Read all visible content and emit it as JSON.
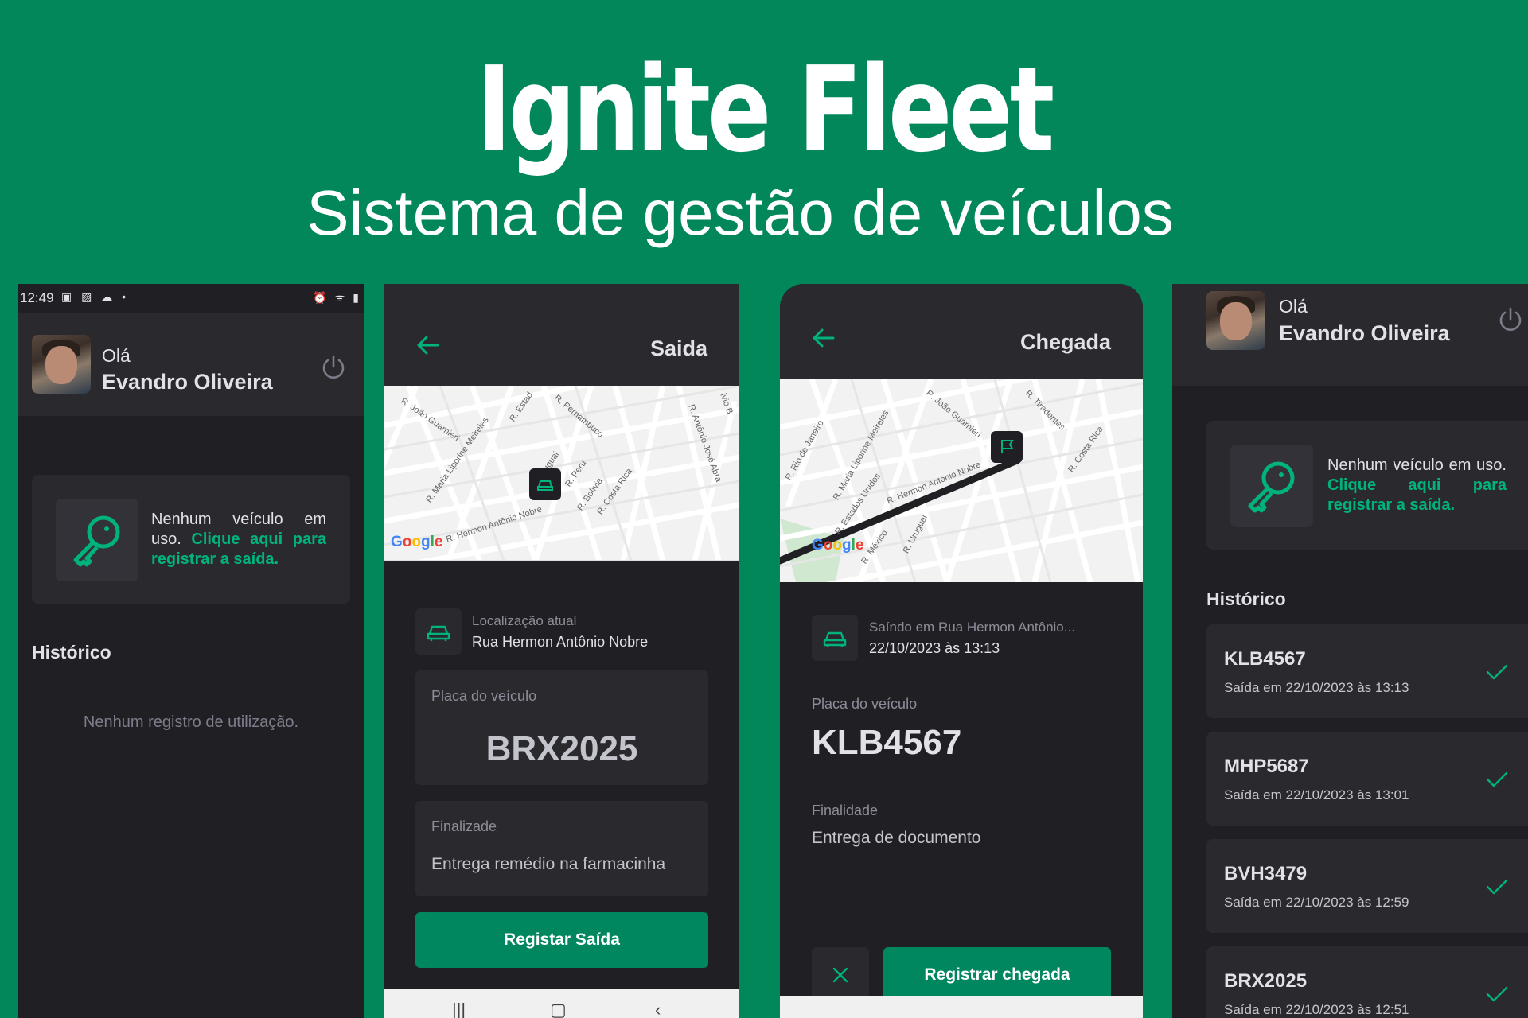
{
  "hero": {
    "title": "Ignite Fleet",
    "subtitle": "Sistema de gestão de veículos"
  },
  "colors": {
    "brand_green": "#01875a",
    "accent": "#00b37e",
    "button": "#00875f",
    "background": "#202024",
    "surface": "#29292e"
  },
  "statusbar": {
    "time": "12:49",
    "left_icons": "▣ ▨ ☁ •",
    "right_icons": "⏰ ᯤ ▮"
  },
  "user": {
    "greeting": "Olá",
    "name": "Evandro Oliveira"
  },
  "home": {
    "card_text_prefix": "Nenhum veículo em uso.",
    "card_link": "Clique aqui para registrar a saída.",
    "history_title": "Histórico",
    "empty_history": "Nenhum registro de utilização."
  },
  "departure": {
    "title": "Saida",
    "location_label": "Localização atual",
    "location_value": "Rua Hermon Antônio Nobre",
    "plate_label": "Placa do veículo",
    "plate_value": "BRX2025",
    "purpose_label": "Finalizade",
    "purpose_value": "Entrega remédio na farmacinha",
    "submit_label": "Registar Saída",
    "streets": [
      "R. João Guarnieri",
      "R. Maria Liporine Meireles",
      "R. Estad",
      "R. Pernambuco",
      "Uruguai",
      "R. Peru",
      "R. Bolívia",
      "R. Costa Rica",
      "R. Hermon Antônio Nobre",
      "R. Antônio José Abra",
      "ivio B"
    ]
  },
  "arrival": {
    "title": "Chegada",
    "departure_info": "Saíndo em Rua Hermon Antônio...",
    "departure_datetime": "22/10/2023 às 13:13",
    "plate_label": "Placa do veículo",
    "plate_value": "KLB4567",
    "purpose_label": "Finalidade",
    "purpose_value": "Entrega de documento",
    "submit_label": "Registrar chegada",
    "streets": [
      "R. Rio de Janeiro",
      "R. Maria Liporine Meireles",
      "R. João Guarnieri",
      "R. Tiradentes",
      "R. Costa Rica",
      "R. Estados Unidos",
      "R. Hermon Antônio Nobre",
      "R. México",
      "R. Uruguai"
    ]
  },
  "map": {
    "brand": "Google"
  },
  "history": {
    "title": "Histórico",
    "items": [
      {
        "plate": "KLB4567",
        "date": "Saída em 22/10/2023 às 13:13"
      },
      {
        "plate": "MHP5687",
        "date": "Saída em 22/10/2023 às 13:01"
      },
      {
        "plate": "BVH3479",
        "date": "Saída em 22/10/2023 às 12:59"
      },
      {
        "plate": "BRX2025",
        "date": "Saída em 22/10/2023 às 12:51"
      }
    ]
  },
  "navbar": {
    "recents": "|||",
    "home": "▢",
    "back": "‹"
  }
}
